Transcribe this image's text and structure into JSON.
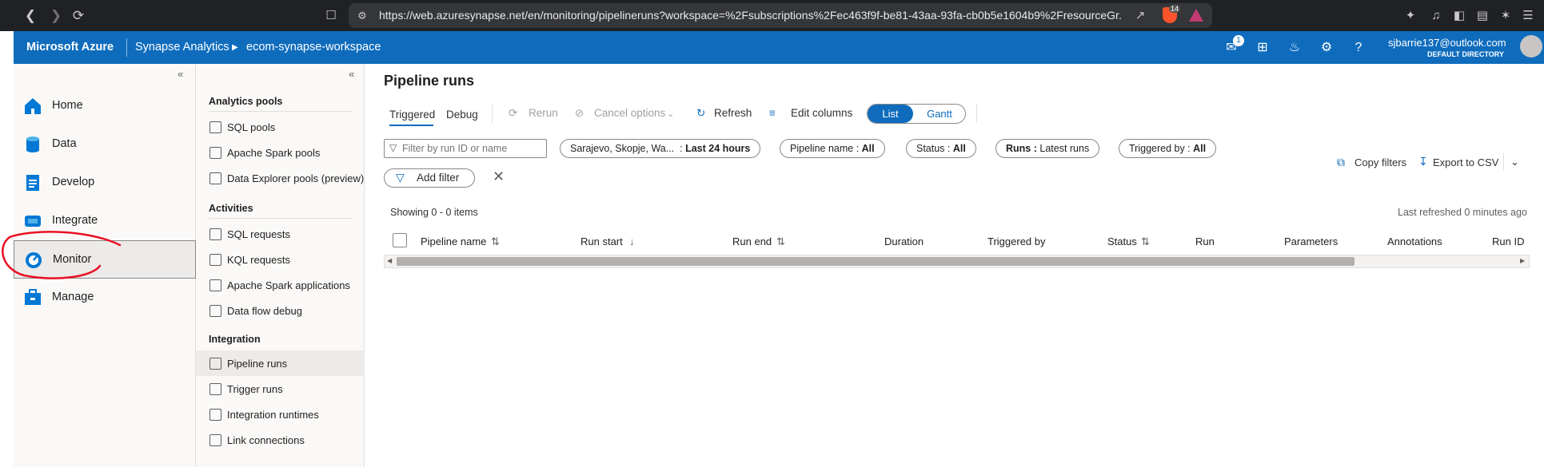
{
  "browser": {
    "url": "https://web.azuresynapse.net/en/monitoring/pipelineruns?workspace=%2Fsubscriptions%2Fec463f9f-be81-43aa-93fa-cb0b5e1604b9%2FresourceGr...",
    "shield_badge": "14"
  },
  "header": {
    "brand": "Microsoft Azure",
    "service": "Synapse Analytics",
    "workspace": "ecom-synapse-workspace",
    "notification_count": "1",
    "user_email": "sjbarrie137@outlook.com",
    "directory": "DEFAULT DIRECTORY"
  },
  "leftnav": {
    "items": [
      {
        "label": "Home"
      },
      {
        "label": "Data"
      },
      {
        "label": "Develop"
      },
      {
        "label": "Integrate"
      },
      {
        "label": "Monitor"
      },
      {
        "label": "Manage"
      }
    ]
  },
  "subnav": {
    "groups": [
      {
        "title": "Analytics pools",
        "items": [
          "SQL pools",
          "Apache Spark pools",
          "Data Explorer pools (preview)"
        ]
      },
      {
        "title": "Activities",
        "items": [
          "SQL requests",
          "KQL requests",
          "Apache Spark applications",
          "Data flow debug"
        ]
      },
      {
        "title": "Integration",
        "items": [
          "Pipeline runs",
          "Trigger runs",
          "Integration runtimes",
          "Link connections"
        ]
      }
    ]
  },
  "main": {
    "title": "Pipeline runs",
    "tabs": [
      "Triggered",
      "Debug"
    ],
    "toolbar": {
      "rerun": "Rerun",
      "cancel": "Cancel options",
      "refresh": "Refresh",
      "edit_columns": "Edit columns",
      "view_list": "List",
      "view_gantt": "Gantt"
    },
    "filter_placeholder": "Filter by run ID or name",
    "filters": {
      "timezone": "Sarajevo, Skopje, Wa...",
      "time_range": "Last 24 hours",
      "pipeline_label": "Pipeline name :",
      "pipeline_value": "All",
      "status_label": "Status :",
      "status_value": "All",
      "runs_label": "Runs :",
      "runs_value": "Latest runs",
      "triggered_label": "Triggered by :",
      "triggered_value": "All"
    },
    "add_filter": "Add filter",
    "copy_filters": "Copy filters",
    "export_csv": "Export to CSV",
    "showing": "Showing 0 - 0 items",
    "last_refreshed": "Last refreshed 0 minutes ago",
    "columns": [
      "Pipeline name",
      "Run start",
      "Run end",
      "Duration",
      "Triggered by",
      "Status",
      "Run",
      "Parameters",
      "Annotations",
      "Run ID"
    ]
  },
  "colors": {
    "azure_blue": "#0f6cbd",
    "annotation_red": "#e81123"
  }
}
